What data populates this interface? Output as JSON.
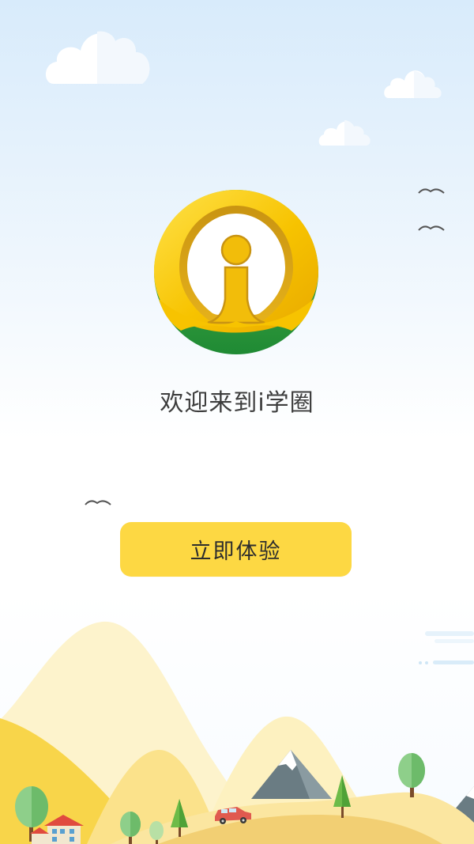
{
  "welcome": {
    "text": "欢迎来到i学圈"
  },
  "cta": {
    "label": "立即体验"
  },
  "colors": {
    "button": "#fdd843",
    "logo_gold": "#f5c400",
    "logo_green": "#2e9b3f",
    "sky_top": "#d8ebfb"
  },
  "icons": {
    "logo": "i-circle-logo",
    "decor": [
      "cloud",
      "bird",
      "mountain",
      "tree",
      "house",
      "car"
    ]
  }
}
